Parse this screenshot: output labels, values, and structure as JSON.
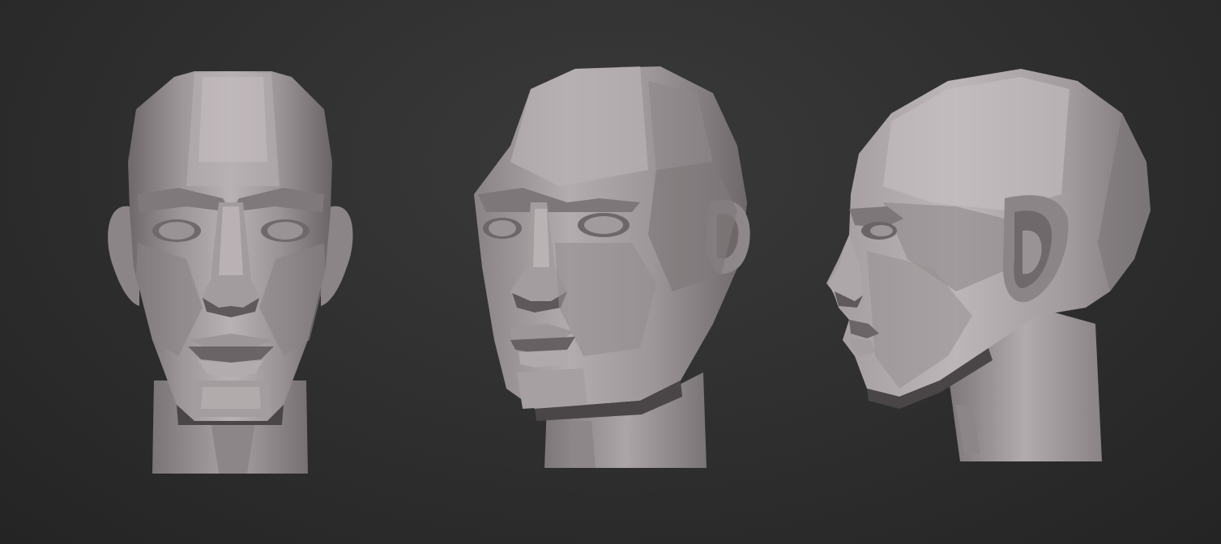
{
  "scene": {
    "background_color": "#2e2e2e",
    "clay_color": "#a8a1a2",
    "views": [
      "front",
      "three-quarter",
      "profile"
    ]
  }
}
